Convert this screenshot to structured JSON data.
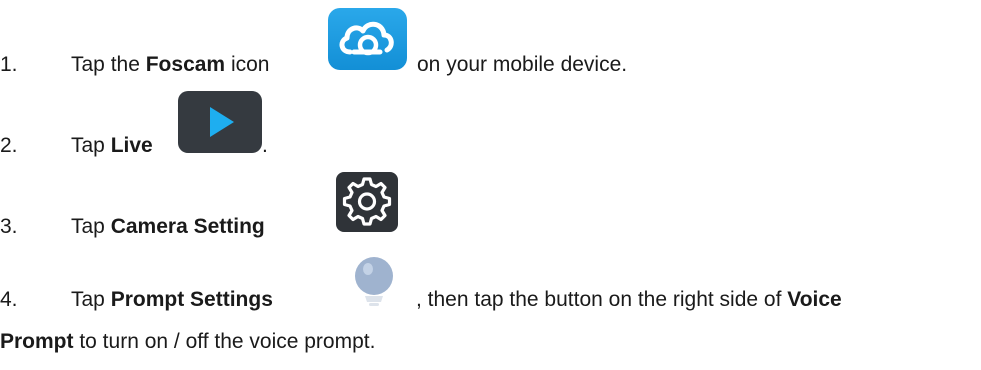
{
  "steps": [
    {
      "number": "1.",
      "pre": "Tap the ",
      "bold": "Foscam",
      "mid": " icon",
      "post": " on your mobile device.",
      "icon": "foscam-cloud-app-icon"
    },
    {
      "number": "2.",
      "pre": "Tap ",
      "bold": "Live",
      "post": ".",
      "icon": "play-icon"
    },
    {
      "number": "3.",
      "pre": "Tap ",
      "bold": "Camera Setting",
      "icon": "gear-icon"
    },
    {
      "number": "4.",
      "pre": "Tap ",
      "bold": "Prompt Settings",
      "post": ", then tap the button on the right side of ",
      "bold2": "Voice",
      "line2_bold": "Prompt",
      "line2_rest": " to turn on / off the voice prompt.",
      "icon": "lightbulb-icon"
    }
  ],
  "colors": {
    "foscam_icon_bg": "#1c9ae0",
    "live_icon_bg": "#353a40",
    "live_play": "#1eaef0",
    "settings_icon_bg": "#2f3338",
    "bulb": "#9fb3cf"
  }
}
